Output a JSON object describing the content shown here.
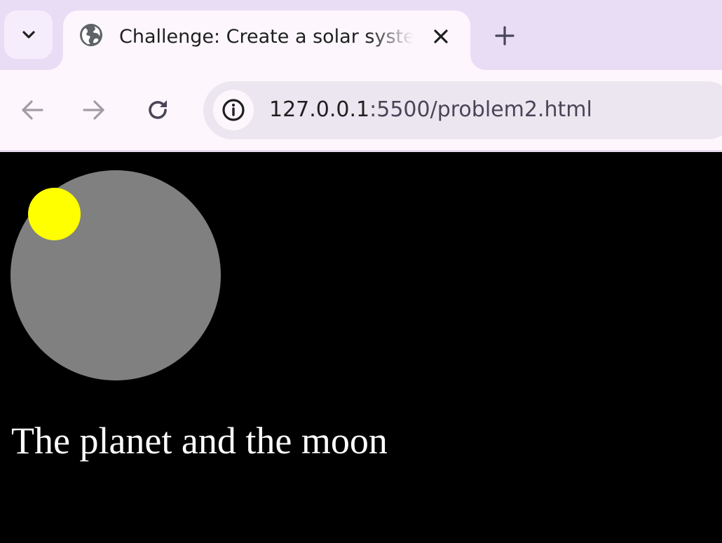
{
  "browser": {
    "tab": {
      "title": "Challenge: Create a solar system",
      "favicon": "globe-icon"
    },
    "tab_search_icon": "chevron-down-icon",
    "close_icon": "close-icon",
    "new_tab_icon": "plus-icon",
    "toolbar": {
      "back_icon": "arrow-left-icon",
      "forward_icon": "arrow-right-icon",
      "reload_icon": "reload-icon",
      "site_info_icon": "info-icon"
    },
    "url": {
      "host": "127.0.0.1",
      "rest": ":5500/problem2.html"
    },
    "colors": {
      "tabstrip": "#e9ddf6",
      "toolbar": "#fdf7fd",
      "omnibox": "#ece6f0"
    }
  },
  "page": {
    "background": "#000000",
    "planet_color": "#808080",
    "moon_color": "#ffff00",
    "caption": "The planet and the moon"
  }
}
